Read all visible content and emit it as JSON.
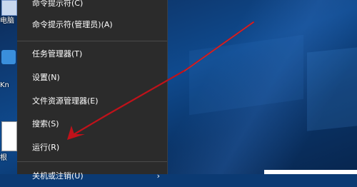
{
  "desktop": {
    "icons": [
      {
        "label": "电脑"
      },
      {
        "label": "Kn"
      },
      {
        "label": "根"
      }
    ]
  },
  "context_menu": {
    "items": [
      {
        "label": "命令提示符(C)"
      },
      {
        "label": "命令提示符(管理员)(A)"
      },
      {
        "label": "任务管理器(T)"
      },
      {
        "label": "设置(N)"
      },
      {
        "label": "文件资源管理器(E)"
      },
      {
        "label": "搜索(S)"
      },
      {
        "label": "运行(R)"
      },
      {
        "label": "关机或注销(U)"
      }
    ],
    "submenu_arrow": "›"
  },
  "annotation": {
    "color": "#c0121a"
  }
}
